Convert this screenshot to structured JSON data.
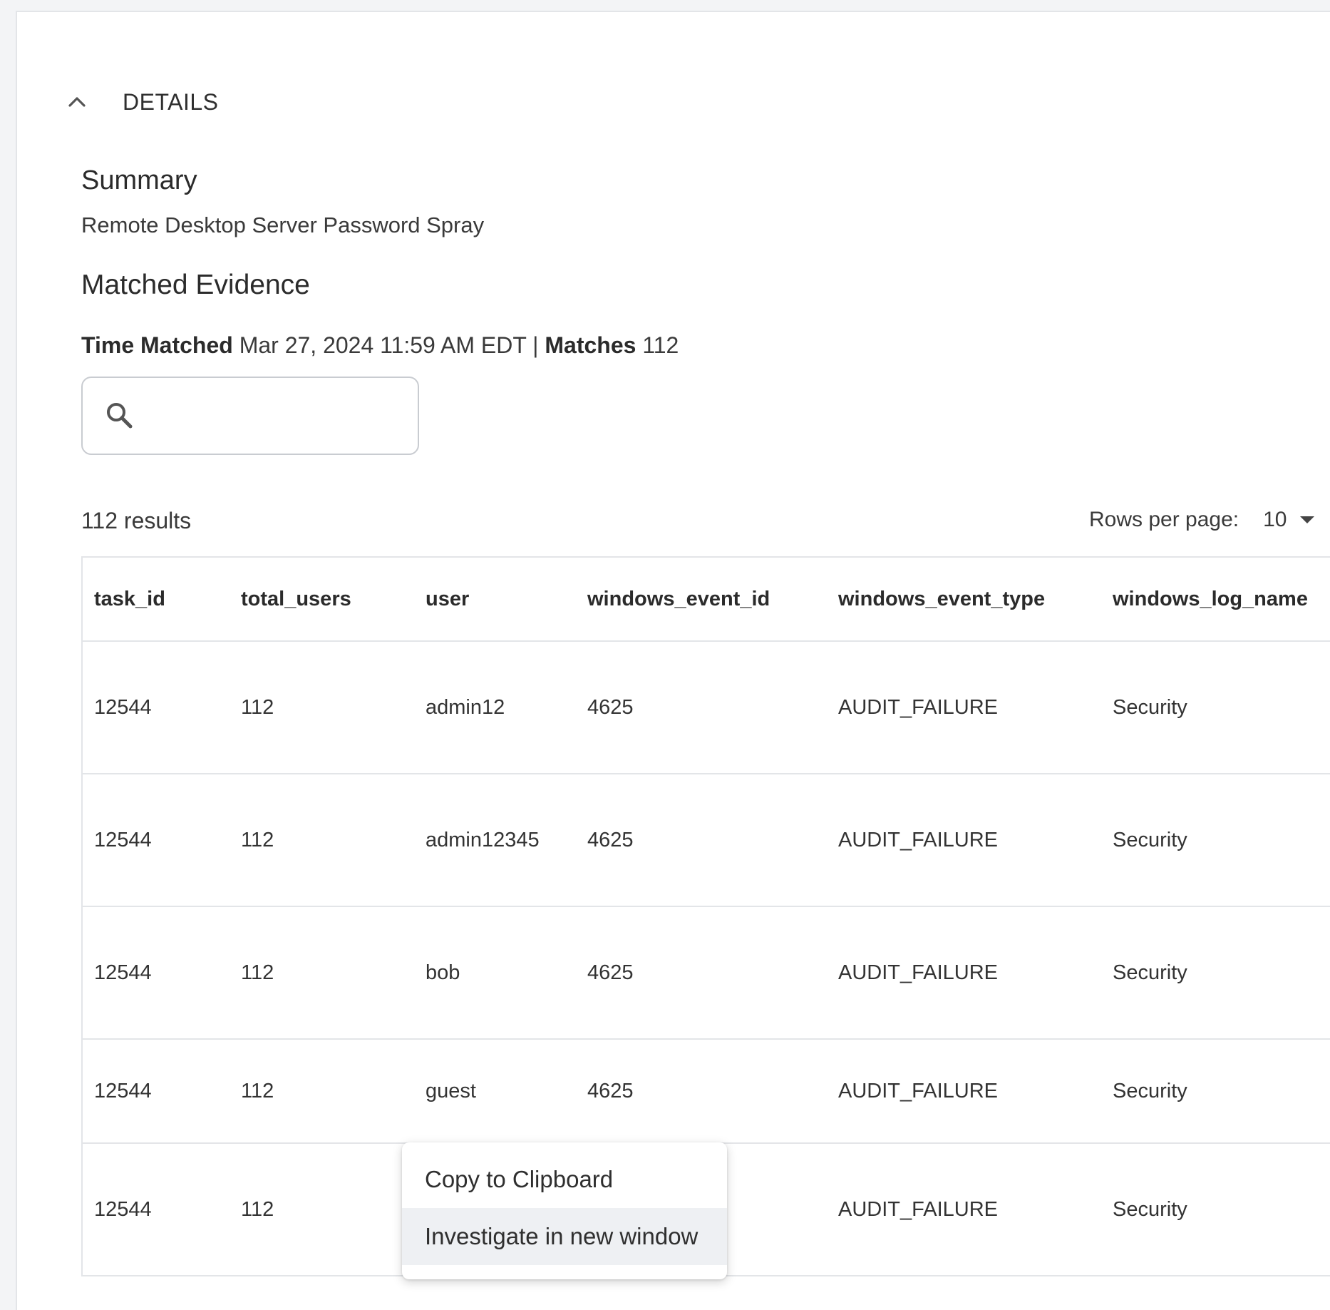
{
  "details": {
    "title": "DETAILS"
  },
  "summary": {
    "title": "Summary",
    "text": "Remote Desktop Server Password Spray"
  },
  "evidence": {
    "title": "Matched Evidence",
    "time_label": "Time Matched",
    "time_value": "Mar 27, 2024 11:59 AM EDT",
    "separator": "|",
    "matches_label": "Matches",
    "matches_value": "112"
  },
  "search": {
    "placeholder": "",
    "value": ""
  },
  "results": {
    "count_text": "112 results",
    "rows_per_page_label": "Rows per page:",
    "rows_per_page_value": "10"
  },
  "table": {
    "columns": [
      "task_id",
      "total_users",
      "user",
      "windows_event_id",
      "windows_event_type",
      "windows_log_name"
    ],
    "rows": [
      [
        "12544",
        "112",
        "admin12",
        "4625",
        "AUDIT_FAILURE",
        "Security"
      ],
      [
        "12544",
        "112",
        "admin12345",
        "4625",
        "AUDIT_FAILURE",
        "Security"
      ],
      [
        "12544",
        "112",
        "bob",
        "4625",
        "AUDIT_FAILURE",
        "Security"
      ],
      [
        "12544",
        "112",
        "guest",
        "4625",
        "AUDIT_FAILURE",
        "Security"
      ],
      [
        "12544",
        "112",
        "",
        "",
        "AUDIT_FAILURE",
        "Security"
      ]
    ]
  },
  "context_menu": {
    "items": [
      "Copy to Clipboard",
      "Investigate in new window"
    ]
  }
}
